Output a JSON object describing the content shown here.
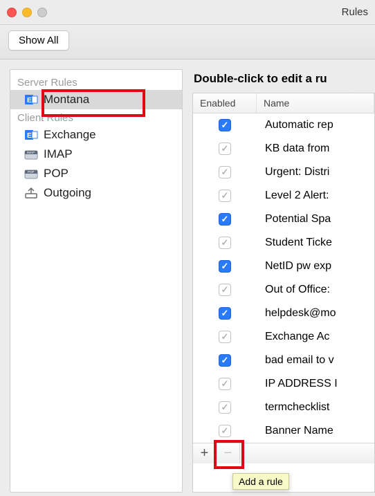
{
  "window": {
    "title": "Rules"
  },
  "toolbar": {
    "show_all": "Show All"
  },
  "sidebar": {
    "server_header": "Server Rules",
    "client_header": "Client Rules",
    "server_items": [
      {
        "label": "Montana",
        "icon": "exchange-icon",
        "selected": true
      }
    ],
    "client_items": [
      {
        "label": "Exchange",
        "icon": "exchange-icon"
      },
      {
        "label": "IMAP",
        "icon": "imap-icon"
      },
      {
        "label": "POP",
        "icon": "pop-icon"
      },
      {
        "label": "Outgoing",
        "icon": "outgoing-icon"
      }
    ]
  },
  "main": {
    "instruction": "Double-click to edit a ru",
    "columns": {
      "enabled": "Enabled",
      "name": "Name"
    },
    "rules": [
      {
        "enabled": true,
        "name": "Automatic rep"
      },
      {
        "enabled": false,
        "name": "KB data from"
      },
      {
        "enabled": false,
        "name": "Urgent: Distri"
      },
      {
        "enabled": false,
        "name": "Level 2 Alert:"
      },
      {
        "enabled": true,
        "name": "Potential Spa"
      },
      {
        "enabled": false,
        "name": "Student Ticke"
      },
      {
        "enabled": true,
        "name": "NetID pw exp"
      },
      {
        "enabled": false,
        "name": "Out of Office:"
      },
      {
        "enabled": true,
        "name": "helpdesk@mo"
      },
      {
        "enabled": false,
        "name": "Exchange Ac"
      },
      {
        "enabled": true,
        "name": "bad email to v"
      },
      {
        "enabled": false,
        "name": "IP ADDRESS I"
      },
      {
        "enabled": false,
        "name": "termchecklist"
      },
      {
        "enabled": false,
        "name": "Banner Name"
      }
    ],
    "tooltip": "Add a rule"
  },
  "icons": {
    "check": "✓",
    "plus": "+",
    "minus": "−"
  }
}
